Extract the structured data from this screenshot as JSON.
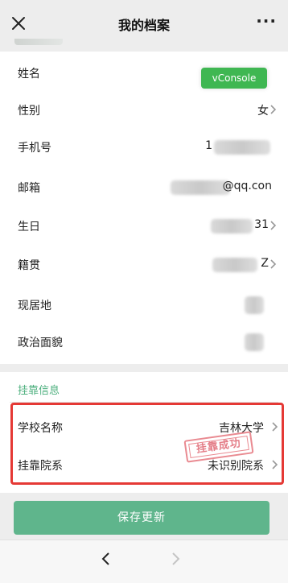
{
  "header": {
    "title": "我的档案"
  },
  "profile": {
    "rows": [
      {
        "label": "姓名"
      },
      {
        "label": "性别",
        "value": "女"
      },
      {
        "label": "手机号",
        "value": "1"
      },
      {
        "label": "邮箱",
        "value": "@qq.con"
      },
      {
        "label": "生日",
        "value": "31"
      },
      {
        "label": "籍贯",
        "value": "Z"
      },
      {
        "label": "现居地"
      },
      {
        "label": "政治面貌"
      }
    ],
    "vconsole_label": "vConsole"
  },
  "affiliation": {
    "section_title": "挂靠信息",
    "rows": [
      {
        "label": "学校名称",
        "value": "吉林大学"
      },
      {
        "label": "挂靠院系",
        "value": "未识别院系"
      }
    ],
    "stamp_text": "挂靠成功"
  },
  "save_button_label": "保存更新",
  "colors": {
    "accent": "#5fb58c",
    "highlight": "#e53935",
    "stamp": "#e06874",
    "vconsole": "#3fb752"
  }
}
